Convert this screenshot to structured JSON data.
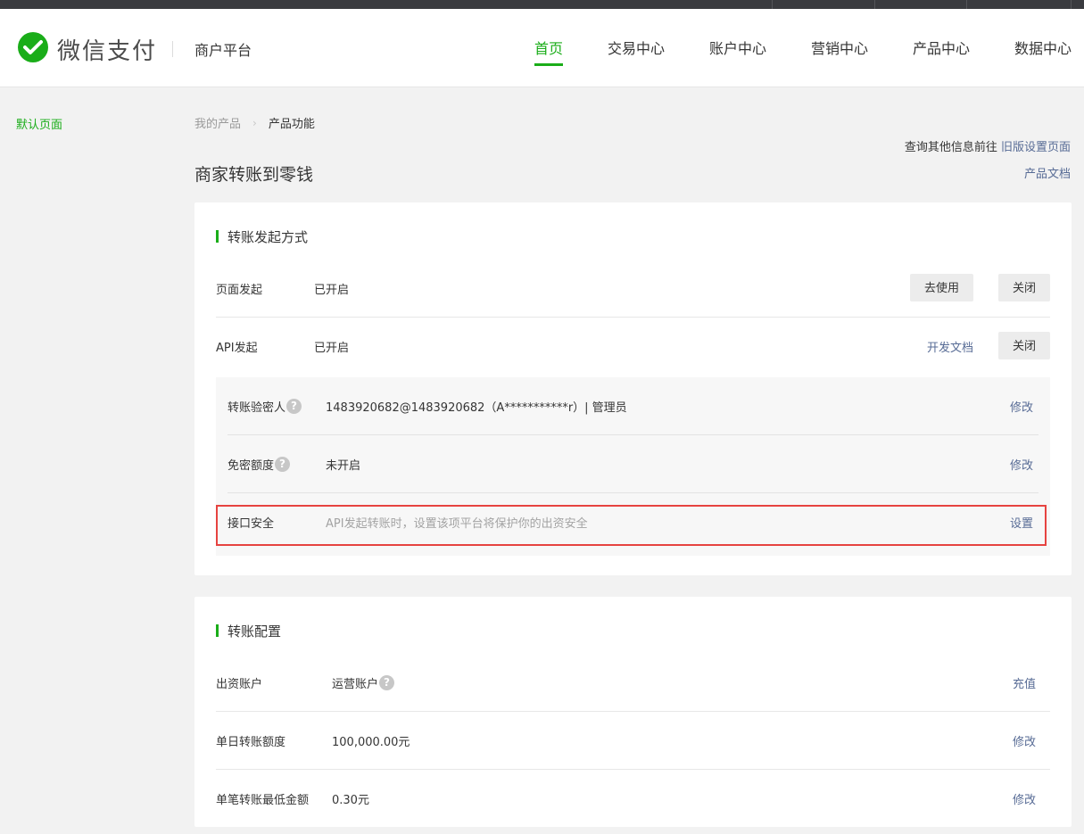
{
  "header": {
    "brand": "微信支付",
    "platform": "商户平台",
    "nav": [
      {
        "label": "首页",
        "active": true
      },
      {
        "label": "交易中心",
        "active": false
      },
      {
        "label": "账户中心",
        "active": false
      },
      {
        "label": "营销中心",
        "active": false
      },
      {
        "label": "产品中心",
        "active": false
      },
      {
        "label": "数据中心",
        "active": false
      }
    ]
  },
  "sidebar": {
    "items": [
      {
        "label": "默认页面"
      }
    ]
  },
  "breadcrumb": {
    "parent": "我的产品",
    "current": "产品功能"
  },
  "page": {
    "title": "商家转账到零钱",
    "old_settings_prefix": "查询其他信息前往",
    "old_settings_link": "旧版设置页面",
    "product_doc_link": "产品文档"
  },
  "initiation": {
    "title": "转账发起方式",
    "page_row": {
      "label": "页面发起",
      "status": "已开启",
      "use_button": "去使用",
      "close_button": "关闭"
    },
    "api_row": {
      "label": "API发起",
      "status": "已开启",
      "doc_link": "开发文档",
      "close_button": "关闭"
    },
    "verifier": {
      "label": "转账验密人",
      "value": "1483920682@1483920682（A***********r）| 管理员",
      "action": "修改"
    },
    "free_quota": {
      "label": "免密额度",
      "value": "未开启",
      "action": "修改"
    },
    "api_security": {
      "label": "接口安全",
      "hint": "API发起转账时，设置该项平台将保护你的出资安全",
      "action": "设置"
    }
  },
  "config": {
    "title": "转账配置",
    "funding_account": {
      "label": "出资账户",
      "value": "运营账户",
      "action": "充值"
    },
    "daily_limit": {
      "label": "单日转账额度",
      "value": "100,000.00元",
      "action": "修改"
    },
    "min_amount": {
      "label": "单笔转账最低金额",
      "value": "0.30元",
      "action": "修改"
    }
  },
  "colors": {
    "accent": "#1aad19",
    "link": "#576b95",
    "highlight": "#e64340"
  },
  "icons": {
    "help": "question-circle-icon",
    "brand": "wechat-pay-logo-icon"
  }
}
